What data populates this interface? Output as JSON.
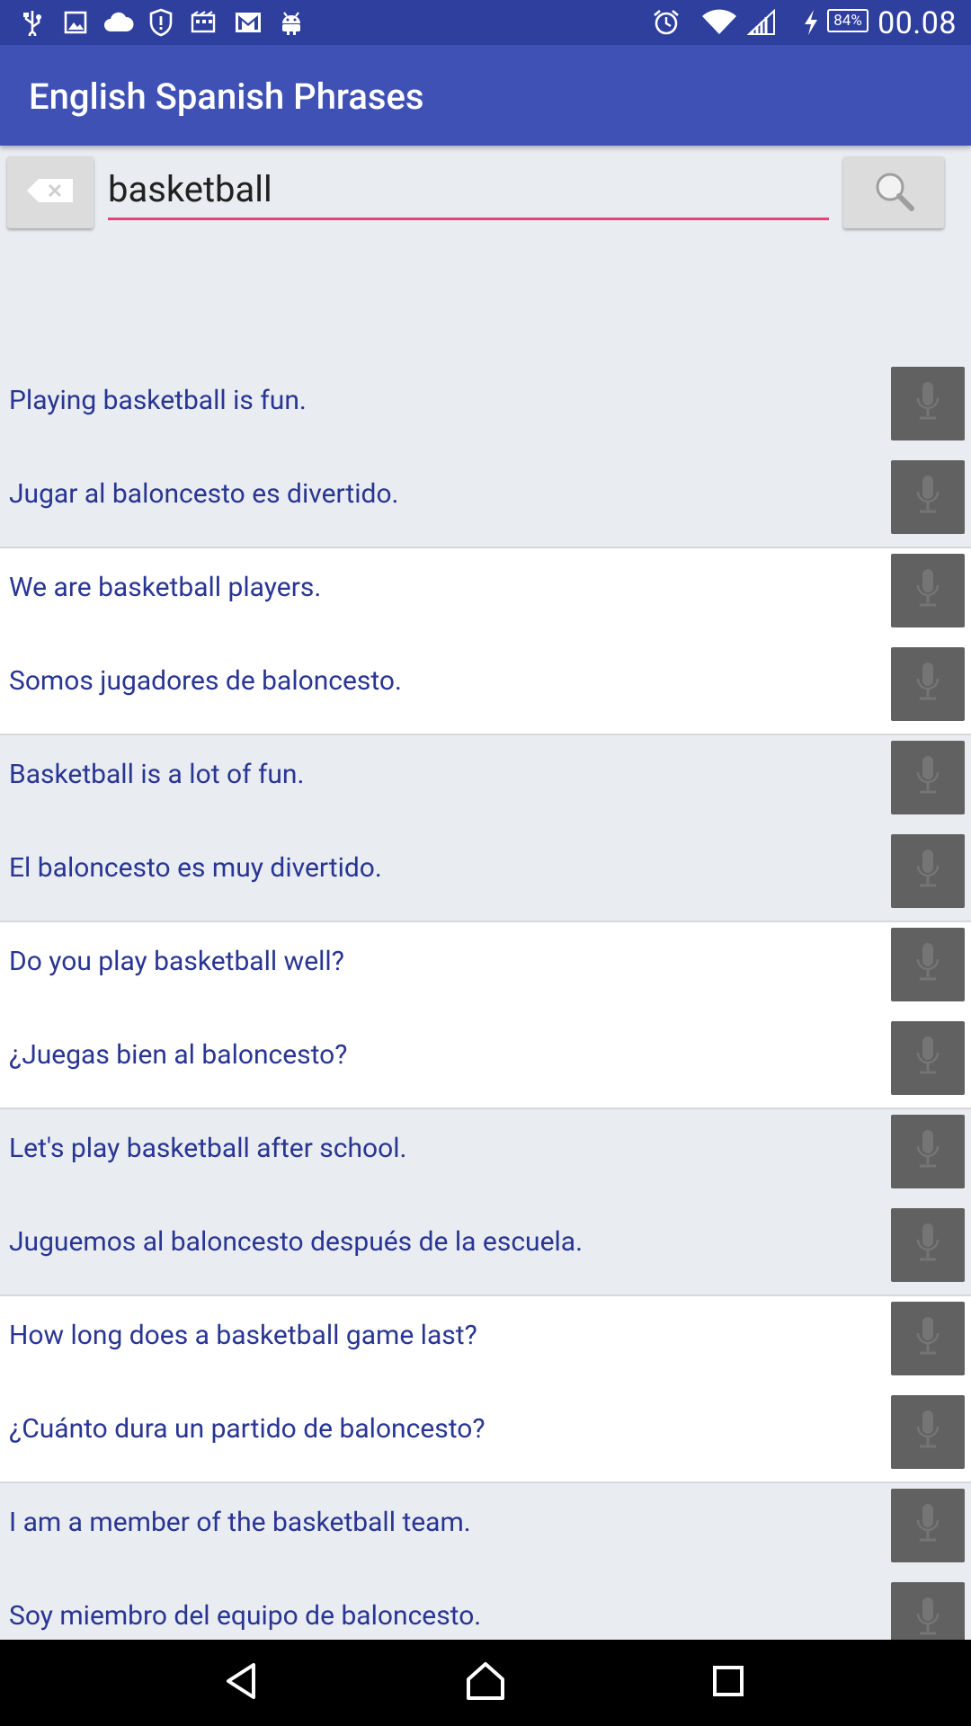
{
  "status_bar": {
    "time": "00.08",
    "battery": "84%",
    "left_icons": [
      "usb-icon",
      "image-icon",
      "cloud-icon",
      "shield-alert-icon",
      "film-icon",
      "gmail-icon",
      "android-icon"
    ],
    "right_icons": [
      "alarm-icon",
      "wifi-icon",
      "signal-icon",
      "charging-icon"
    ]
  },
  "app_bar": {
    "title": "English Spanish Phrases"
  },
  "search": {
    "value": "basketball",
    "clear_icon": "backspace-icon",
    "search_icon": "magnifier-icon"
  },
  "results": [
    {
      "english": "Playing basketball is fun.",
      "spanish": "Jugar al baloncesto es divertido."
    },
    {
      "english": "We are basketball players.",
      "spanish": "Somos jugadores de baloncesto."
    },
    {
      "english": "Basketball is a lot of fun.",
      "spanish": "El baloncesto es muy divertido."
    },
    {
      "english": "Do you play basketball well?",
      "spanish": "¿Juegas bien al baloncesto?"
    },
    {
      "english": "Let's play basketball after school.",
      "spanish": "Juguemos al baloncesto después de la escuela."
    },
    {
      "english": "How long does a basketball game last?",
      "spanish": "¿Cuánto dura un partido de baloncesto?"
    },
    {
      "english": "I am a member of the basketball team.",
      "spanish": "Soy miembro del equipo de baloncesto."
    }
  ],
  "colors": {
    "status_bar": "#2f3f9e",
    "app_bar": "#3f51b5",
    "accent": "#ec407a",
    "phrase_text": "#283593",
    "mic_button": "#616161"
  },
  "nav_bar": {
    "icons": [
      "back-icon",
      "home-icon",
      "recents-icon"
    ]
  }
}
